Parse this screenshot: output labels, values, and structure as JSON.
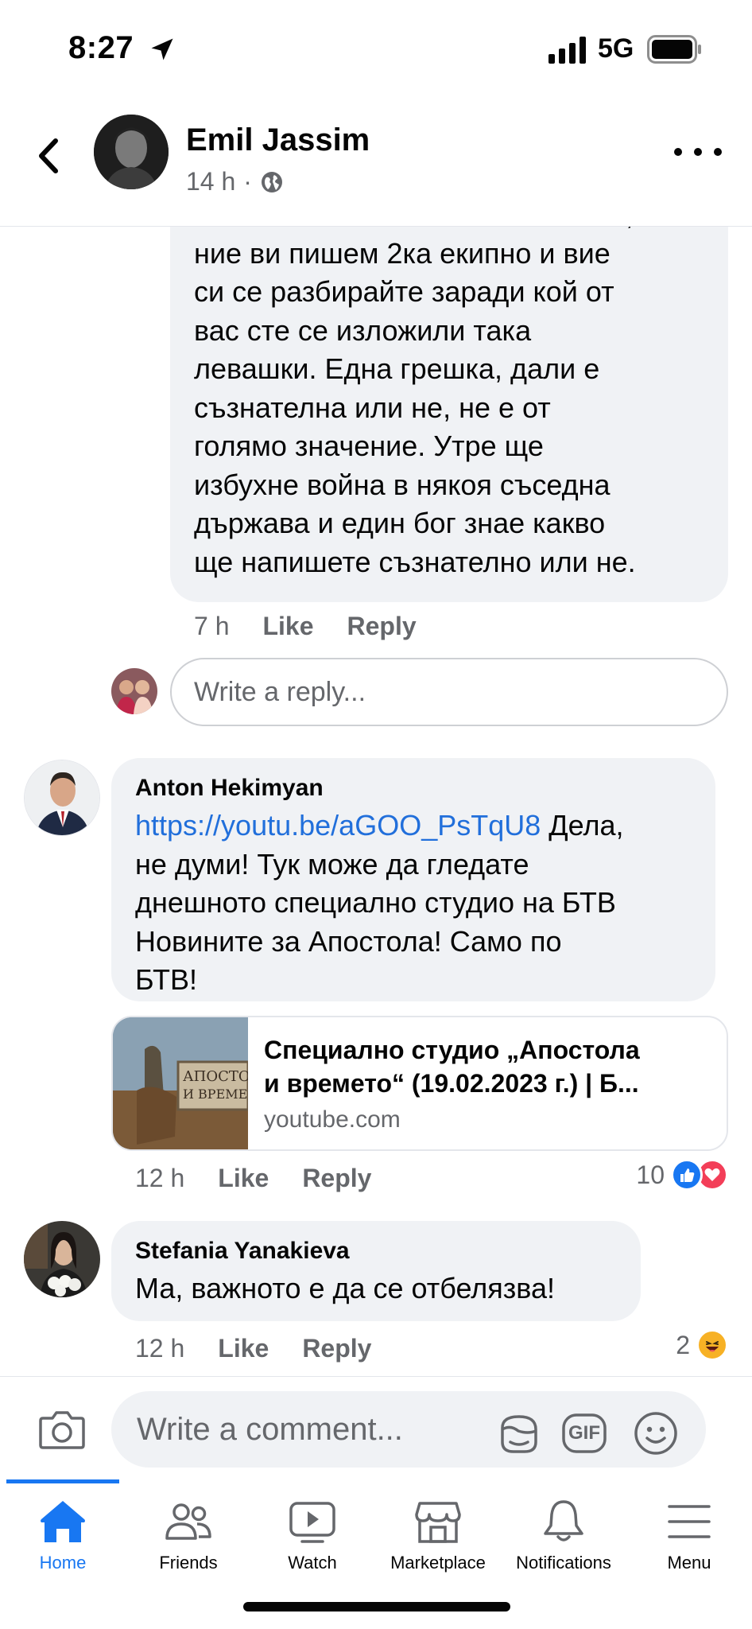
{
  "status_bar": {
    "time": "8:27",
    "network": "5G"
  },
  "header": {
    "name": "Emil Jassim",
    "time": "14 h",
    "dot": "·"
  },
  "comments": [
    {
      "text_lines": [
        "несъзнателна не помагаха. Така,",
        "ние ви пишем 2ка екипно и вие",
        "си се разбирайте заради кой от",
        "вас сте се изложили така",
        "левашки. Една грешка, дали е",
        "съзнателна или не, не е от",
        "голямо значение. Утре ще",
        "избухне война в някоя съседна",
        "държава и един бог знае какво",
        "ще напишете съзнателно или не."
      ],
      "time": "7 h",
      "like": "Like",
      "reply": "Reply"
    },
    {
      "author": "Anton Hekimyan",
      "link": "https://youtu.be/aGOO_PsTqU8",
      "text_first": " Дела,",
      "text_lines": [
        "не думи! Тук може да гледате",
        "днешното специално студио на БТВ",
        "Новините за Апостола! Само по",
        "БТВ!"
      ],
      "link_card": {
        "title_line1": "Специално студио „Апостола",
        "title_line2": "и времето“ (19.02.2023 г.) | Б...",
        "domain": "youtube.com",
        "thumb_text_1": "АПОСТО",
        "thumb_text_2": "И ВРЕМЕ"
      },
      "time": "12 h",
      "like": "Like",
      "reply": "Reply",
      "reaction_count": "10"
    },
    {
      "author": "Stefania Yanakieva",
      "text": "Ма, важното е да се отбелязва!",
      "time": "12 h",
      "like": "Like",
      "reply": "Reply",
      "reaction_count": "2"
    }
  ],
  "reply_input": {
    "placeholder": "Write a reply..."
  },
  "composer": {
    "placeholder": "Write a comment...",
    "gif_label": "GIF"
  },
  "tabs": [
    {
      "label": "Home",
      "icon": "home-icon",
      "active": true
    },
    {
      "label": "Friends",
      "icon": "friends-icon"
    },
    {
      "label": "Watch",
      "icon": "watch-icon"
    },
    {
      "label": "Marketplace",
      "icon": "marketplace-icon"
    },
    {
      "label": "Notifications",
      "icon": "bell-icon"
    },
    {
      "label": "Menu",
      "icon": "menu-icon"
    }
  ],
  "colors": {
    "accent": "#1877f2",
    "link": "#216fdb",
    "bubble": "#f0f2f5",
    "secondary_text": "#65676b",
    "love": "#f33e58",
    "haha": "#f7b125"
  }
}
